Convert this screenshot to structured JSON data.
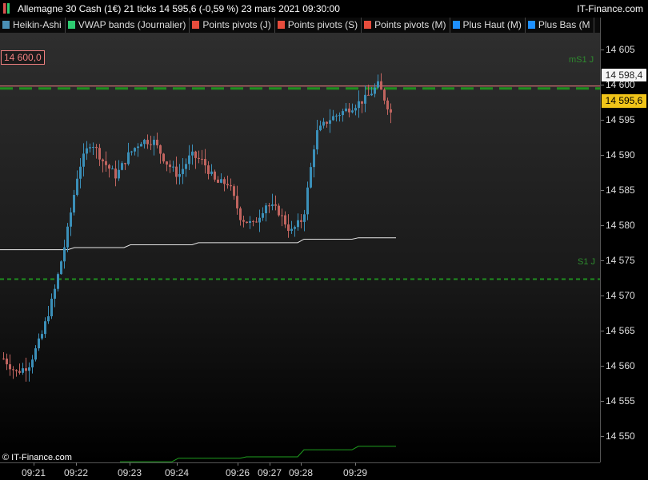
{
  "header": {
    "title": "Allemagne 30 Cash (1€) 21 ticks 14 595,6 (-0,59 %) 23 mars 2021 09:30:00",
    "brand": "IT-Finance.com"
  },
  "legend": [
    {
      "label": "Heikin-Ashi",
      "color": "#4a8fb5"
    },
    {
      "label": "VWAP bands (Journalier)",
      "color": "#2ecc71"
    },
    {
      "label": "Points pivots (J)",
      "color": "#e74c3c"
    },
    {
      "label": "Points pivots (S)",
      "color": "#e74c3c"
    },
    {
      "label": "Points pivots (M)",
      "color": "#e74c3c"
    },
    {
      "label": "Plus Haut (M)",
      "color": "#1e90ff"
    },
    {
      "label": "Plus Bas (M",
      "color": "#1e90ff"
    }
  ],
  "price_labels": {
    "level_left": "14 600,0",
    "prev_price": "14 598,4",
    "last_price": "14 595,6",
    "ms1": "mS1 J",
    "s1": "S1 J"
  },
  "copyright": "© IT-Finance.com",
  "colors": {
    "bull": "#3b8fb8",
    "bear": "#c0645f",
    "pivot": "#1f8f1f",
    "vwap": "#e6e6e6"
  },
  "chart_data": {
    "type": "candlestick-heikin-ashi",
    "y_ticks": [
      14550,
      14555,
      14560,
      14565,
      14570,
      14575,
      14580,
      14585,
      14590,
      14595,
      14600,
      14605
    ],
    "y_tick_labels": [
      "14 550",
      "14 555",
      "14 560",
      "14 565",
      "14 570",
      "14 575",
      "14 580",
      "14 585",
      "14 590",
      "14 595",
      "14 600",
      "14 605"
    ],
    "ylim": [
      14546.2,
      14607.4
    ],
    "x_tick_labels": [
      "09:21",
      "09:22",
      "09:23",
      "09:24",
      "09:26",
      "09:27",
      "09:28",
      "09:29"
    ],
    "levels": {
      "mS1_J": 14599.8,
      "price_marker": 14600.0,
      "S1_J": 14572.3
    },
    "vwap_upper_segments": [
      [
        0,
        14576.5
      ],
      [
        85,
        14576.8
      ],
      [
        155,
        14577.2
      ],
      [
        240,
        14577.5
      ],
      [
        300,
        14577.5
      ],
      [
        372,
        14578.0
      ],
      [
        440,
        14578.2
      ],
      [
        487,
        14578.2
      ]
    ],
    "vwap_lower_segments": [
      [
        150,
        14546.3
      ],
      [
        215,
        14546.8
      ],
      [
        300,
        14547.0
      ],
      [
        372,
        14548.0
      ],
      [
        440,
        14548.5
      ],
      [
        487,
        14548.5
      ]
    ],
    "candles_seed": {
      "count": 122,
      "path": [
        14561,
        14559,
        14560,
        14564,
        14570,
        14578,
        14588,
        14592,
        14589,
        14587,
        14590,
        14592,
        14592,
        14589,
        14587,
        14590,
        14589,
        14586,
        14586,
        14581,
        14580,
        14583,
        14582,
        14579,
        14581,
        14593,
        14595,
        14596,
        14597,
        14598,
        14600,
        14596
      ]
    }
  }
}
